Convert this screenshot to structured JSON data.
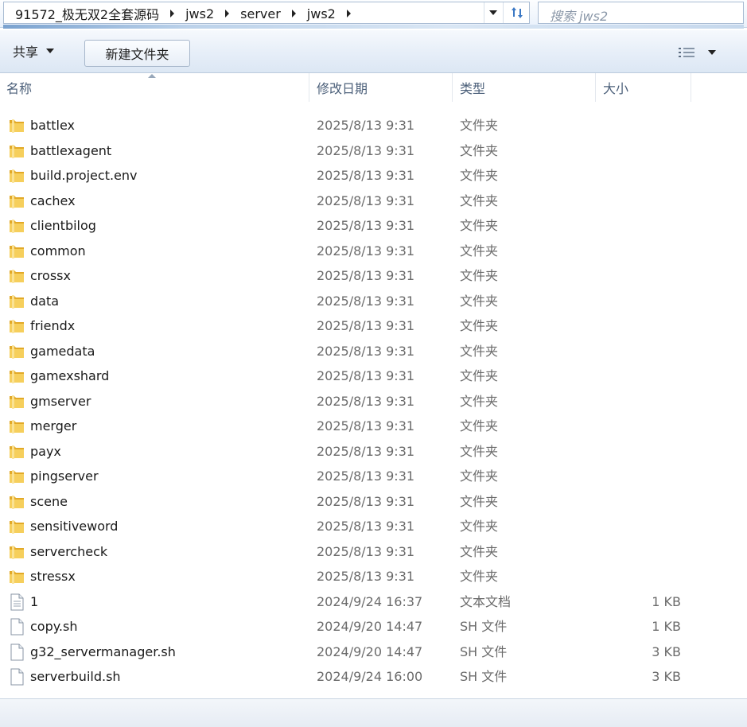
{
  "address_bar": {
    "crumbs": [
      "91572_极无双2全套源码",
      "jws2",
      "server",
      "jws2"
    ]
  },
  "search": {
    "placeholder": "搜索 jws2"
  },
  "toolbar": {
    "share_label": "共享",
    "new_folder_label": "新建文件夹"
  },
  "columns": {
    "name": "名称",
    "date": "修改日期",
    "type": "类型",
    "size": "大小"
  },
  "files": [
    {
      "name": "battlex",
      "date": "2025/8/13 9:31",
      "type": "文件夹",
      "size": "",
      "icon": "folder-icon"
    },
    {
      "name": "battlexagent",
      "date": "2025/8/13 9:31",
      "type": "文件夹",
      "size": "",
      "icon": "folder-icon"
    },
    {
      "name": "build.project.env",
      "date": "2025/8/13 9:31",
      "type": "文件夹",
      "size": "",
      "icon": "folder-icon"
    },
    {
      "name": "cachex",
      "date": "2025/8/13 9:31",
      "type": "文件夹",
      "size": "",
      "icon": "folder-icon"
    },
    {
      "name": "clientbilog",
      "date": "2025/8/13 9:31",
      "type": "文件夹",
      "size": "",
      "icon": "folder-icon"
    },
    {
      "name": "common",
      "date": "2025/8/13 9:31",
      "type": "文件夹",
      "size": "",
      "icon": "folder-icon"
    },
    {
      "name": "crossx",
      "date": "2025/8/13 9:31",
      "type": "文件夹",
      "size": "",
      "icon": "folder-icon"
    },
    {
      "name": "data",
      "date": "2025/8/13 9:31",
      "type": "文件夹",
      "size": "",
      "icon": "folder-icon"
    },
    {
      "name": "friendx",
      "date": "2025/8/13 9:31",
      "type": "文件夹",
      "size": "",
      "icon": "folder-icon"
    },
    {
      "name": "gamedata",
      "date": "2025/8/13 9:31",
      "type": "文件夹",
      "size": "",
      "icon": "folder-icon"
    },
    {
      "name": "gamexshard",
      "date": "2025/8/13 9:31",
      "type": "文件夹",
      "size": "",
      "icon": "folder-icon"
    },
    {
      "name": "gmserver",
      "date": "2025/8/13 9:31",
      "type": "文件夹",
      "size": "",
      "icon": "folder-icon"
    },
    {
      "name": "merger",
      "date": "2025/8/13 9:31",
      "type": "文件夹",
      "size": "",
      "icon": "folder-icon"
    },
    {
      "name": "payx",
      "date": "2025/8/13 9:31",
      "type": "文件夹",
      "size": "",
      "icon": "folder-icon"
    },
    {
      "name": "pingserver",
      "date": "2025/8/13 9:31",
      "type": "文件夹",
      "size": "",
      "icon": "folder-icon"
    },
    {
      "name": "scene",
      "date": "2025/8/13 9:31",
      "type": "文件夹",
      "size": "",
      "icon": "folder-icon"
    },
    {
      "name": "sensitiveword",
      "date": "2025/8/13 9:31",
      "type": "文件夹",
      "size": "",
      "icon": "folder-icon"
    },
    {
      "name": "servercheck",
      "date": "2025/8/13 9:31",
      "type": "文件夹",
      "size": "",
      "icon": "folder-icon"
    },
    {
      "name": "stressx",
      "date": "2025/8/13 9:31",
      "type": "文件夹",
      "size": "",
      "icon": "folder-icon"
    },
    {
      "name": "1",
      "date": "2024/9/24 16:37",
      "type": "文本文档",
      "size": "1 KB",
      "icon": "text-file-icon"
    },
    {
      "name": "copy.sh",
      "date": "2024/9/20 14:47",
      "type": "SH 文件",
      "size": "1 KB",
      "icon": "file-icon"
    },
    {
      "name": "g32_servermanager.sh",
      "date": "2024/9/20 14:47",
      "type": "SH 文件",
      "size": "3 KB",
      "icon": "file-icon"
    },
    {
      "name": "serverbuild.sh",
      "date": "2024/9/24 16:00",
      "type": "SH 文件",
      "size": "3 KB",
      "icon": "file-icon"
    }
  ],
  "colors": {
    "folder": "#f0c24a",
    "toolbar_bg": "#e6eef8",
    "header_text": "#4c607a"
  }
}
